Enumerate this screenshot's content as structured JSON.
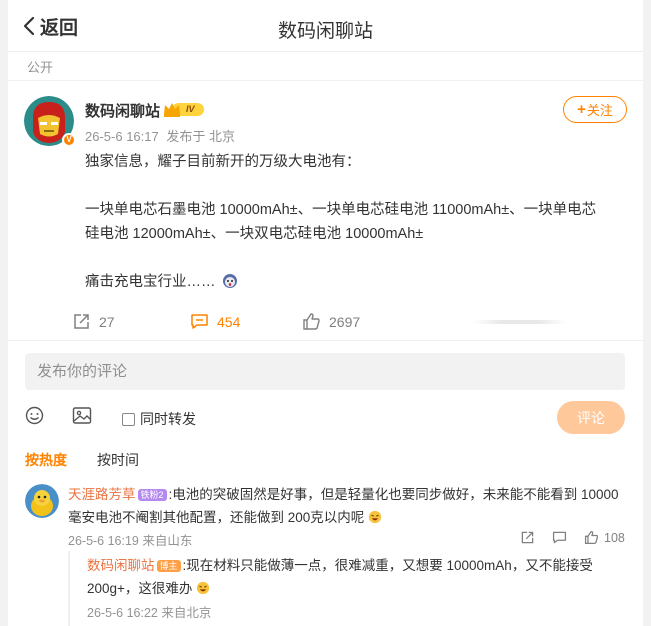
{
  "header": {
    "back_label": "返回",
    "title": "数码闲聊站"
  },
  "visibility": "公开",
  "author": {
    "name": "数码闲聊站",
    "level_badge": "IV",
    "verified_badge": "V",
    "time": "26-5-6 16:17",
    "source": "发布于 北京",
    "follow_label": "关注"
  },
  "post": {
    "lines": [
      "独家信息，耀子目前新开的万级大电池有：",
      "一块单电芯石墨电池 10000mAh±、一块单电芯硅电池 11000mAh±、一块单电芯",
      "硅电池 12000mAh±、一块双电芯硅电池 10000mAh±",
      "痛击充电宝行业……"
    ]
  },
  "actions": {
    "reposts": "27",
    "comments": "454",
    "likes": "2697"
  },
  "composer": {
    "placeholder": "发布你的评论",
    "repost_label": "同时转发",
    "submit_label": "评论"
  },
  "sort_tabs": {
    "hot": "按热度",
    "time": "按时间"
  },
  "comments": [
    {
      "user": "天涯路芳草",
      "badge": "铁粉2",
      "text": ":电池的突破固然是好事，但是轻量化也要同步做好，未来能不能看到 10000",
      "text2": "毫安电池不阉割其他配置，还能做到 200克以内呢",
      "time": "26-5-6 16:19 来自山东",
      "likes": "108",
      "reply": {
        "user": "数码闲聊站",
        "badge": "博主",
        "text": ":现在材料只能做薄一点，很难减重，又想要 10000mAh，又不能接受",
        "text2": "200g+，这很难办",
        "time": "26-5-6 16:22 来自北京"
      }
    }
  ],
  "colors": {
    "accent": "#ff8200",
    "username": "#eb7340",
    "meta": "#939393"
  }
}
